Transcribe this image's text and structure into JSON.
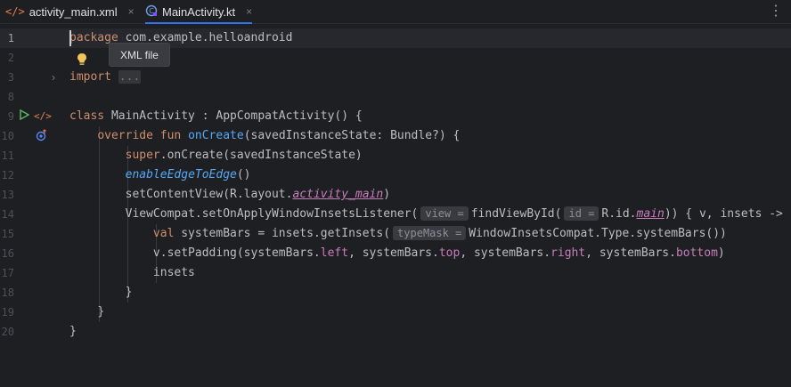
{
  "tabs": [
    {
      "label": "activity_main.xml",
      "icon": "xml-file-icon",
      "close": "×"
    },
    {
      "label": "MainActivity.kt",
      "icon": "kotlin-class-icon",
      "close": "×"
    }
  ],
  "more_label": "⋮",
  "tooltip": "XML file",
  "line_numbers": [
    "1",
    "2",
    "3",
    "8",
    "9",
    "10",
    "11",
    "12",
    "13",
    "14",
    "15",
    "16",
    "17",
    "18",
    "19",
    "20"
  ],
  "code": {
    "l1": {
      "a": "package",
      "b": " com.example.helloandroid"
    },
    "l3": {
      "kw": "import",
      "fold": "..."
    },
    "l9": {
      "kw": "class",
      "b": " MainActivity : AppCompatActivity() {"
    },
    "l10": {
      "kw1": "override",
      "kw2": "fun",
      "fn": "onCreate",
      "rest": "(savedInstanceState: Bundle?) {"
    },
    "l11": {
      "kw": "super",
      "dot": ".",
      "fn": "onCreate",
      "rest": "(savedInstanceState)"
    },
    "l12": {
      "fn": "enableEdgeToEdge",
      "rest": "()"
    },
    "l13": {
      "a": "setContentView(R.layout.",
      "prop": "activity_main",
      "b": ")"
    },
    "l14": {
      "a": "ViewCompat.setOnApplyWindowInsetsListener(",
      "hint1": "view =",
      "b": "findViewById(",
      "hint2": "id =",
      "c": "R.id.",
      "prop": "main",
      "d": ")) { v, insets ->"
    },
    "l15": {
      "kw": "val",
      "a": " systemBars = insets.getInsets(",
      "hint": "typeMask =",
      "b": "WindowInsetsCompat.Type.systemBars())"
    },
    "l16": {
      "a": "v.setPadding(systemBars.",
      "p1": "left",
      "s1": ", systemBars.",
      "p2": "top",
      "s2": ", systemBars.",
      "p3": "right",
      "s3": ", systemBars.",
      "p4": "bottom",
      "s4": ")"
    },
    "l17": {
      "a": "insets"
    },
    "l18": {
      "a": "}"
    },
    "l19": {
      "a": "}"
    },
    "l20": {
      "a": "}"
    }
  },
  "colors": {
    "accent": "#3574f0",
    "keyword": "#cf8e6d",
    "function": "#56a8f5",
    "property": "#c77dbb",
    "ok": "#5fb865"
  }
}
